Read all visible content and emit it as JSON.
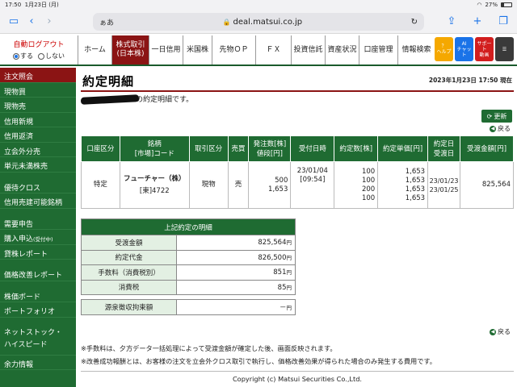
{
  "statusbar": {
    "time": "17:50",
    "date": "1月23日 (月)",
    "battery": "27%"
  },
  "browser": {
    "aa": "ぁあ",
    "url": "deal.matsui.co.jp"
  },
  "login": {
    "title": "自動ログアウト",
    "opt_on": "する",
    "opt_off": "しない"
  },
  "nav": [
    "ホーム",
    "株式取引\n(日本株)",
    "一日信用",
    "米国株",
    "先物ＯＰ",
    "ＦＸ",
    "投資信託",
    "資産状況",
    "口座管理",
    "情報検索"
  ],
  "help_icons": [
    {
      "label": "？\nヘルプ",
      "color": "#f5a800"
    },
    {
      "label": "AI\nチャット",
      "color": "#1a73e8"
    },
    {
      "label": "サポート\n動画",
      "color": "#d21e1e"
    },
    {
      "label": "☰",
      "color": "#3a3a3a"
    }
  ],
  "sidebar": {
    "items": [
      "注文照会",
      "現物買",
      "現物売",
      "信用新規",
      "信用返済",
      "立会外分売",
      "単元未満株売"
    ],
    "items2": [
      "優待クロス",
      "信用売建可能銘柄"
    ],
    "items3": [
      "需要申告"
    ],
    "apply_main": "購入申込",
    "apply_sub": "(受付中)",
    "items4": [
      "貸株レポート"
    ],
    "items5": [
      "価格改善レポート"
    ],
    "items6": [
      "株価ボード",
      "ポートフォリオ"
    ],
    "items7": [
      "ネットストック・\nハイスピード"
    ],
    "items8": [
      "余力情報"
    ]
  },
  "page": {
    "title": "約定明細",
    "date": "2023年1月23日 17:50 現在",
    "intro": "の約定明細です。",
    "update_label": "更新",
    "back_label": "戻る"
  },
  "exec_table": {
    "headers": [
      "口座区分",
      "銘柄\n[市場]コード",
      "取引区分",
      "売買",
      "発注数[株]\n値段[円]",
      "受付日時",
      "約定数[株]",
      "約定単価[円]",
      "約定日\n受渡日",
      "受渡金額[円]"
    ],
    "row": {
      "account": "特定",
      "name": "フューチャー（株）",
      "code": "[東]4722",
      "type": "現物",
      "side": "売",
      "order_qty": "500",
      "order_price": "1,653",
      "recv": "23/01/04\n[09:54]",
      "exec_qty": "100\n100\n200\n100",
      "exec_price": "1,653\n1,653\n1,653\n1,653",
      "dates": "23/01/23\n23/01/25",
      "amount": "825,564"
    }
  },
  "summary": {
    "title": "上記約定の明細",
    "unit": "円",
    "rows": [
      {
        "label": "受渡金額",
        "value": "825,564"
      },
      {
        "label": "約定代金",
        "value": "826,500"
      },
      {
        "label": "手数料（消費税別）",
        "value": "851"
      },
      {
        "label": "消費税",
        "value": "85"
      }
    ],
    "tax": {
      "label": "源泉徴収拘束額",
      "value": "－"
    }
  },
  "notes": [
    "※手数料は、夕方データ一括処理によって受渡金額が確定した後、画面反映されます。",
    "※改善成功報酬とは、お客様の注文を立会外クロス取引で執行し、価格改善効果が得られた場合のみ発生する費用です。"
  ],
  "copyright": "Copyright (c) Matsui Securities Co.,Ltd."
}
